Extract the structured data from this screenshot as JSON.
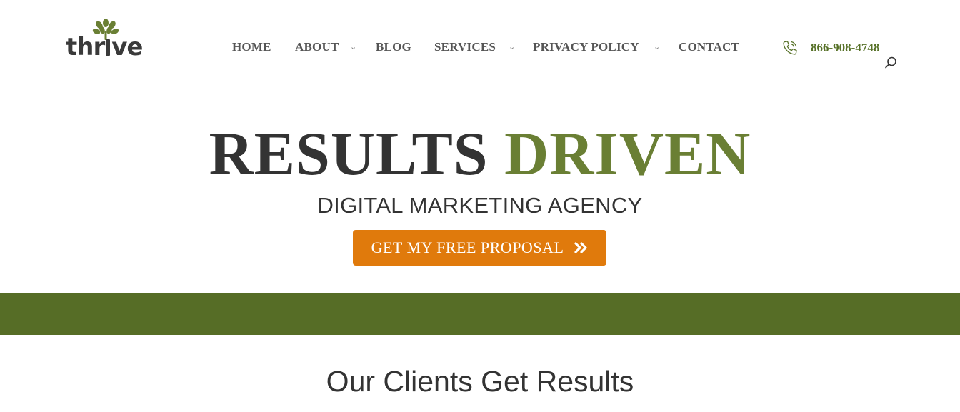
{
  "logo": {
    "text_prefix": "thr",
    "text_suffix": "ve",
    "icon": "tree-icon",
    "color": "#6a7f34"
  },
  "nav": {
    "items": [
      {
        "label": "HOME",
        "has_dropdown": false
      },
      {
        "label": "ABOUT",
        "has_dropdown": true
      },
      {
        "label": "BLOG",
        "has_dropdown": false
      },
      {
        "label": "SERVICES",
        "has_dropdown": true
      },
      {
        "label": "PRIVACY POLICY",
        "has_dropdown": true
      },
      {
        "label": "CONTACT",
        "has_dropdown": false
      }
    ],
    "caret_glyph": "⌄"
  },
  "phone": {
    "number": "866-908-4748",
    "icon": "phone-icon",
    "color": "#577128"
  },
  "search": {
    "icon": "search-icon"
  },
  "hero": {
    "title_word1": "RESULTS",
    "title_word2": "DRIVEN",
    "subtitle": "DIGITAL MARKETING AGENCY",
    "cta_label": "GET MY FREE PROPOSAL",
    "cta_icon": "double-chevron-right-icon",
    "cta_color": "#e07a0c",
    "accent_color": "#6a7f34"
  },
  "band": {
    "color": "#566d26"
  },
  "section": {
    "title": "Our Clients Get Results"
  }
}
